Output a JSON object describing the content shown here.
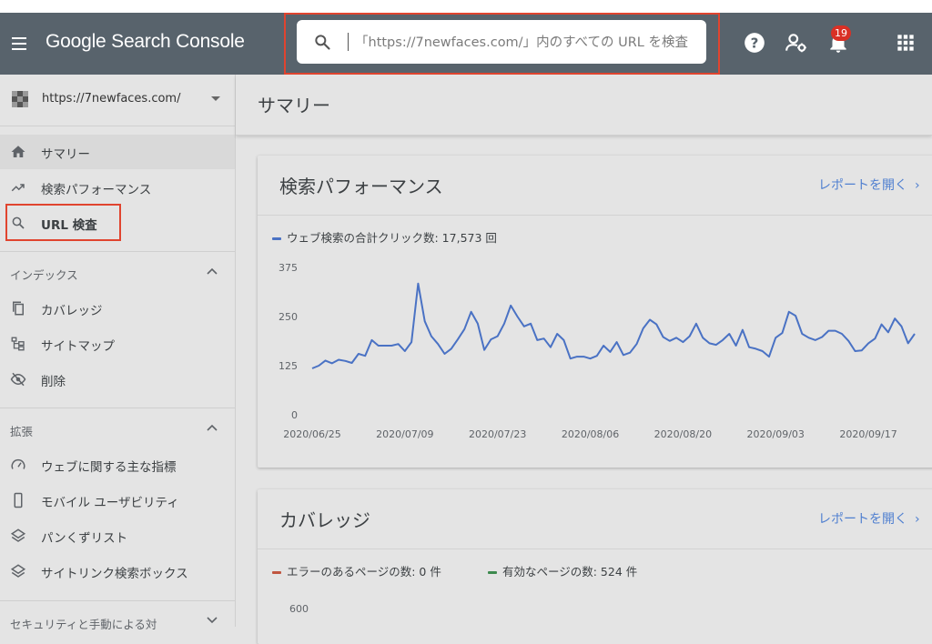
{
  "header": {
    "logo": "Google Search Console",
    "search_placeholder": "「https://7newfaces.com/」内のすべての URL を検査",
    "notification_count": "19",
    "icons": [
      "menu-icon",
      "search-icon",
      "help-icon",
      "manage-users-icon",
      "bell-icon",
      "apps-grid-icon"
    ]
  },
  "sidebar": {
    "property": "https://7newfaces.com/",
    "main_items": [
      {
        "label": "サマリー",
        "icon": "home-icon"
      },
      {
        "label": "検索パフォーマンス",
        "icon": "trending-up-icon"
      },
      {
        "label": "URL 検査",
        "icon": "search-icon"
      }
    ],
    "sections": [
      {
        "title": "インデックス",
        "items": [
          {
            "label": "カバレッジ",
            "icon": "copy-pages-icon"
          },
          {
            "label": "サイトマップ",
            "icon": "sitemap-icon"
          },
          {
            "label": "削除",
            "icon": "eye-off-icon"
          }
        ]
      },
      {
        "title": "拡張",
        "items": [
          {
            "label": "ウェブに関する主な指標",
            "icon": "speedometer-icon"
          },
          {
            "label": "モバイル ユーザビリティ",
            "icon": "smartphone-icon"
          },
          {
            "label": "パンくずリスト",
            "icon": "layers-icon"
          },
          {
            "label": "サイトリンク検索ボックス",
            "icon": "layers-icon"
          }
        ]
      },
      {
        "title": "セキュリティと手動による対"
      }
    ]
  },
  "main": {
    "page_title": "サマリー",
    "performance_card": {
      "title": "検索パフォーマンス",
      "link": "レポートを開く",
      "legend": "ウェブ検索の合計クリック数: 17,573 回"
    },
    "coverage_card": {
      "title": "カバレッジ",
      "link": "レポートを開く",
      "legend_error": "エラーのあるページの数: 0 件",
      "legend_valid": "有効なページの数: 524 件",
      "ytick_top": "600"
    }
  },
  "colors": {
    "header_bg": "#58636c",
    "series_blue": "#4a72c4",
    "error_red": "#c0553f",
    "valid_green": "#3d8a4e",
    "highlight_outline": "#e0442f",
    "link_blue": "#4f7fd0"
  },
  "chart_data": {
    "type": "line",
    "title": "",
    "xlabel": "",
    "ylabel": "",
    "ylim": [
      0,
      375
    ],
    "yticks": [
      "0",
      "125",
      "250",
      "375"
    ],
    "xticks": [
      "2020/06/25",
      "2020/07/09",
      "2020/07/23",
      "2020/08/06",
      "2020/08/20",
      "2020/09/03",
      "2020/09/17"
    ],
    "series": [
      {
        "name": "ウェブ検索の合計クリック数",
        "x_start": "2020/06/25",
        "values": [
          118,
          125,
          138,
          131,
          140,
          137,
          132,
          155,
          150,
          190,
          176,
          176,
          176,
          180,
          162,
          185,
          334,
          238,
          200,
          180,
          155,
          168,
          192,
          218,
          262,
          232,
          165,
          192,
          200,
          232,
          278,
          250,
          225,
          232,
          190,
          194,
          172,
          206,
          190,
          143,
          148,
          148,
          143,
          150,
          176,
          160,
          185,
          152,
          158,
          180,
          220,
          242,
          230,
          198,
          188,
          196,
          185,
          200,
          232,
          196,
          182,
          178,
          190,
          206,
          176,
          216,
          172,
          168,
          162,
          148,
          196,
          208,
          262,
          252,
          206,
          196,
          190,
          198,
          214,
          214,
          206,
          188,
          162,
          164,
          182,
          194,
          230,
          210,
          245,
          225,
          182,
          206
        ]
      }
    ]
  }
}
